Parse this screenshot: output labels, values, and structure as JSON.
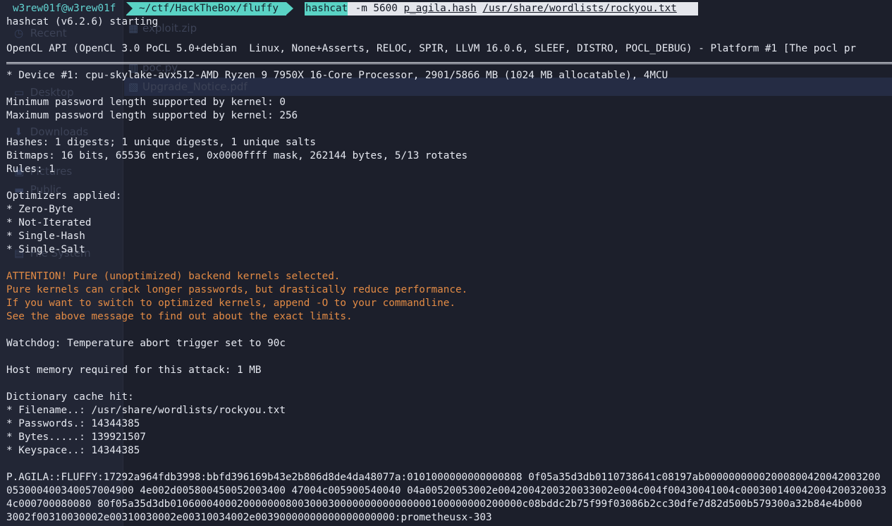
{
  "background_app": {
    "sidebar": [
      {
        "label": "Recent",
        "icon": "clock-icon"
      },
      {
        "label": "Desktop",
        "icon": "desktop-icon"
      },
      {
        "label": "Downloads",
        "icon": "download-icon"
      },
      {
        "label": "Pictures",
        "icon": "picture-icon"
      },
      {
        "label": "Public",
        "icon": "folder-icon"
      },
      {
        "label": "File System",
        "icon": "drive-icon"
      }
    ],
    "files": [
      {
        "label": "exploit.zip",
        "icon": "zip-icon"
      },
      {
        "label": "poc.py",
        "icon": "script-icon"
      },
      {
        "label": "Upgrade_Notice.pdf",
        "icon": "pdf-icon"
      }
    ]
  },
  "prompt": {
    "user_host": "w3rew01f@w3rew01f",
    "path": "~/ctf/HackTheBox/fluffy",
    "command": "hashcat",
    "args_plain": " -m 5600 ",
    "arg_hashfile": "p_agila.hash",
    "arg_space": " ",
    "arg_wordlist": "/usr/share/wordlists/rockyou.txt"
  },
  "output": {
    "start": "hashcat (v6.2.6) starting",
    "opencl": "OpenCL API (OpenCL 3.0 PoCL 5.0+debian  Linux, None+Asserts, RELOC, SPIR, LLVM 16.0.6, SLEEF, DISTRO, POCL_DEBUG) - Platform #1 [The pocl pr",
    "device": "* Device #1: cpu-skylake-avx512-AMD Ryzen 9 7950X 16-Core Processor, 2901/5866 MB (1024 MB allocatable), 4MCU",
    "min_pw": "Minimum password length supported by kernel: 0",
    "max_pw": "Maximum password length supported by kernel: 256",
    "hashes": "Hashes: 1 digests; 1 unique digests, 1 unique salts",
    "bitmaps": "Bitmaps: 16 bits, 65536 entries, 0x0000ffff mask, 262144 bytes, 5/13 rotates",
    "rules": "Rules: 1",
    "optimizers_header": "Optimizers applied:",
    "optimizers": [
      "* Zero-Byte",
      "* Not-Iterated",
      "* Single-Hash",
      "* Single-Salt"
    ],
    "warnings": [
      "ATTENTION! Pure (unoptimized) backend kernels selected.",
      "Pure kernels can crack longer passwords, but drastically reduce performance.",
      "If you want to switch to optimized kernels, append -O to your commandline.",
      "See the above message to find out about the exact limits."
    ],
    "watchdog": "Watchdog: Temperature abort trigger set to 90c",
    "host_memory": "Host memory required for this attack: 1 MB",
    "dict_header": "Dictionary cache hit:",
    "dict": [
      "* Filename..: /usr/share/wordlists/rockyou.txt",
      "* Passwords.: 14344385",
      "* Bytes.....: 139921507",
      "* Keyspace..: 14344385"
    ],
    "cracked": [
      "P.AGILA::FLUFFY:17292a964fdb3998:bbfd396169b43e2b806d8de4da48077a:0101000000000000808 0f05a35d3db0110738641c08197ab00000000002000800420042003200",
      "053000400340057004900 4e002d005800450052003400 47004c005900540040 04a00520053002e0042004200320033002e004c004f00430041004c000300140042004200320033",
      "4c000700080080 80f05a35d3db0106000400020000000800300030000000000000000100000000200000c08bddc2b75f99f03086b2cc30dfe7d82d500b579300a32b84e4b000",
      "3002f00310030002e00310030002e00310034002e00390000000000000000000:prometheusx-303"
    ]
  },
  "colors": {
    "background": "#1c1f2b",
    "text": "#e5e8f0",
    "warning": "#e38b45",
    "prompt_accent": "#5ad3c5"
  }
}
